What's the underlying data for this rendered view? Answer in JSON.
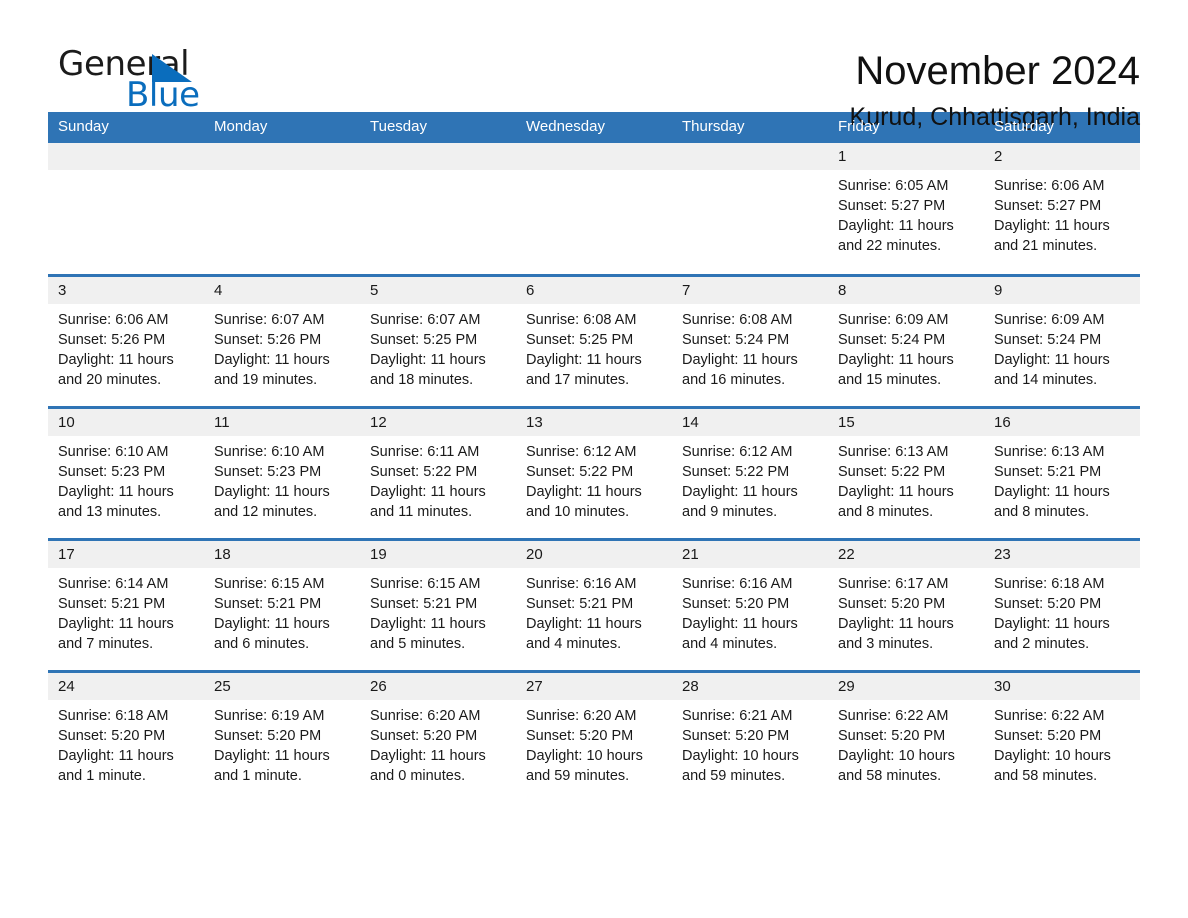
{
  "brand": {
    "word1": "General",
    "word2": "Blue",
    "triangle_color": "#0a6dbd",
    "icon": "triangle-logo-icon"
  },
  "header": {
    "month_title": "November 2024",
    "location": "Kurud, Chhattisgarh, India"
  },
  "colors": {
    "header_blue": "#2f74b5",
    "daynum_band": "#f0f0f0",
    "brand_blue": "#0a6dbd",
    "text": "#1a1a1a"
  },
  "weekdays": [
    "Sunday",
    "Monday",
    "Tuesday",
    "Wednesday",
    "Thursday",
    "Friday",
    "Saturday"
  ],
  "weeks": [
    [
      {
        "day": "",
        "empty": true
      },
      {
        "day": "",
        "empty": true
      },
      {
        "day": "",
        "empty": true
      },
      {
        "day": "",
        "empty": true
      },
      {
        "day": "",
        "empty": true
      },
      {
        "day": "1",
        "sunrise": "Sunrise: 6:05 AM",
        "sunset": "Sunset: 5:27 PM",
        "daylight_l1": "Daylight: 11 hours",
        "daylight_l2": "and 22 minutes."
      },
      {
        "day": "2",
        "sunrise": "Sunrise: 6:06 AM",
        "sunset": "Sunset: 5:27 PM",
        "daylight_l1": "Daylight: 11 hours",
        "daylight_l2": "and 21 minutes."
      }
    ],
    [
      {
        "day": "3",
        "sunrise": "Sunrise: 6:06 AM",
        "sunset": "Sunset: 5:26 PM",
        "daylight_l1": "Daylight: 11 hours",
        "daylight_l2": "and 20 minutes."
      },
      {
        "day": "4",
        "sunrise": "Sunrise: 6:07 AM",
        "sunset": "Sunset: 5:26 PM",
        "daylight_l1": "Daylight: 11 hours",
        "daylight_l2": "and 19 minutes."
      },
      {
        "day": "5",
        "sunrise": "Sunrise: 6:07 AM",
        "sunset": "Sunset: 5:25 PM",
        "daylight_l1": "Daylight: 11 hours",
        "daylight_l2": "and 18 minutes."
      },
      {
        "day": "6",
        "sunrise": "Sunrise: 6:08 AM",
        "sunset": "Sunset: 5:25 PM",
        "daylight_l1": "Daylight: 11 hours",
        "daylight_l2": "and 17 minutes."
      },
      {
        "day": "7",
        "sunrise": "Sunrise: 6:08 AM",
        "sunset": "Sunset: 5:24 PM",
        "daylight_l1": "Daylight: 11 hours",
        "daylight_l2": "and 16 minutes."
      },
      {
        "day": "8",
        "sunrise": "Sunrise: 6:09 AM",
        "sunset": "Sunset: 5:24 PM",
        "daylight_l1": "Daylight: 11 hours",
        "daylight_l2": "and 15 minutes."
      },
      {
        "day": "9",
        "sunrise": "Sunrise: 6:09 AM",
        "sunset": "Sunset: 5:24 PM",
        "daylight_l1": "Daylight: 11 hours",
        "daylight_l2": "and 14 minutes."
      }
    ],
    [
      {
        "day": "10",
        "sunrise": "Sunrise: 6:10 AM",
        "sunset": "Sunset: 5:23 PM",
        "daylight_l1": "Daylight: 11 hours",
        "daylight_l2": "and 13 minutes."
      },
      {
        "day": "11",
        "sunrise": "Sunrise: 6:10 AM",
        "sunset": "Sunset: 5:23 PM",
        "daylight_l1": "Daylight: 11 hours",
        "daylight_l2": "and 12 minutes."
      },
      {
        "day": "12",
        "sunrise": "Sunrise: 6:11 AM",
        "sunset": "Sunset: 5:22 PM",
        "daylight_l1": "Daylight: 11 hours",
        "daylight_l2": "and 11 minutes."
      },
      {
        "day": "13",
        "sunrise": "Sunrise: 6:12 AM",
        "sunset": "Sunset: 5:22 PM",
        "daylight_l1": "Daylight: 11 hours",
        "daylight_l2": "and 10 minutes."
      },
      {
        "day": "14",
        "sunrise": "Sunrise: 6:12 AM",
        "sunset": "Sunset: 5:22 PM",
        "daylight_l1": "Daylight: 11 hours",
        "daylight_l2": "and 9 minutes."
      },
      {
        "day": "15",
        "sunrise": "Sunrise: 6:13 AM",
        "sunset": "Sunset: 5:22 PM",
        "daylight_l1": "Daylight: 11 hours",
        "daylight_l2": "and 8 minutes."
      },
      {
        "day": "16",
        "sunrise": "Sunrise: 6:13 AM",
        "sunset": "Sunset: 5:21 PM",
        "daylight_l1": "Daylight: 11 hours",
        "daylight_l2": "and 8 minutes."
      }
    ],
    [
      {
        "day": "17",
        "sunrise": "Sunrise: 6:14 AM",
        "sunset": "Sunset: 5:21 PM",
        "daylight_l1": "Daylight: 11 hours",
        "daylight_l2": "and 7 minutes."
      },
      {
        "day": "18",
        "sunrise": "Sunrise: 6:15 AM",
        "sunset": "Sunset: 5:21 PM",
        "daylight_l1": "Daylight: 11 hours",
        "daylight_l2": "and 6 minutes."
      },
      {
        "day": "19",
        "sunrise": "Sunrise: 6:15 AM",
        "sunset": "Sunset: 5:21 PM",
        "daylight_l1": "Daylight: 11 hours",
        "daylight_l2": "and 5 minutes."
      },
      {
        "day": "20",
        "sunrise": "Sunrise: 6:16 AM",
        "sunset": "Sunset: 5:21 PM",
        "daylight_l1": "Daylight: 11 hours",
        "daylight_l2": "and 4 minutes."
      },
      {
        "day": "21",
        "sunrise": "Sunrise: 6:16 AM",
        "sunset": "Sunset: 5:20 PM",
        "daylight_l1": "Daylight: 11 hours",
        "daylight_l2": "and 4 minutes."
      },
      {
        "day": "22",
        "sunrise": "Sunrise: 6:17 AM",
        "sunset": "Sunset: 5:20 PM",
        "daylight_l1": "Daylight: 11 hours",
        "daylight_l2": "and 3 minutes."
      },
      {
        "day": "23",
        "sunrise": "Sunrise: 6:18 AM",
        "sunset": "Sunset: 5:20 PM",
        "daylight_l1": "Daylight: 11 hours",
        "daylight_l2": "and 2 minutes."
      }
    ],
    [
      {
        "day": "24",
        "sunrise": "Sunrise: 6:18 AM",
        "sunset": "Sunset: 5:20 PM",
        "daylight_l1": "Daylight: 11 hours",
        "daylight_l2": "and 1 minute."
      },
      {
        "day": "25",
        "sunrise": "Sunrise: 6:19 AM",
        "sunset": "Sunset: 5:20 PM",
        "daylight_l1": "Daylight: 11 hours",
        "daylight_l2": "and 1 minute."
      },
      {
        "day": "26",
        "sunrise": "Sunrise: 6:20 AM",
        "sunset": "Sunset: 5:20 PM",
        "daylight_l1": "Daylight: 11 hours",
        "daylight_l2": "and 0 minutes."
      },
      {
        "day": "27",
        "sunrise": "Sunrise: 6:20 AM",
        "sunset": "Sunset: 5:20 PM",
        "daylight_l1": "Daylight: 10 hours",
        "daylight_l2": "and 59 minutes."
      },
      {
        "day": "28",
        "sunrise": "Sunrise: 6:21 AM",
        "sunset": "Sunset: 5:20 PM",
        "daylight_l1": "Daylight: 10 hours",
        "daylight_l2": "and 59 minutes."
      },
      {
        "day": "29",
        "sunrise": "Sunrise: 6:22 AM",
        "sunset": "Sunset: 5:20 PM",
        "daylight_l1": "Daylight: 10 hours",
        "daylight_l2": "and 58 minutes."
      },
      {
        "day": "30",
        "sunrise": "Sunrise: 6:22 AM",
        "sunset": "Sunset: 5:20 PM",
        "daylight_l1": "Daylight: 10 hours",
        "daylight_l2": "and 58 minutes."
      }
    ]
  ]
}
